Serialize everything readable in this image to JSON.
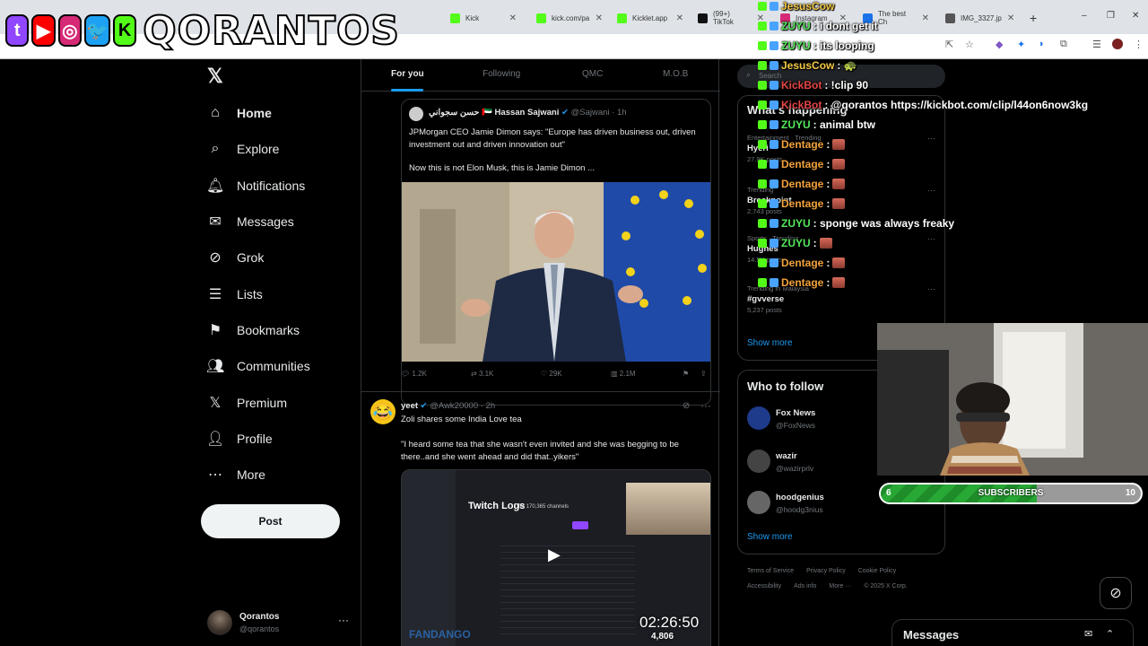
{
  "browser": {
    "tabs": [
      {
        "title": "Kick",
        "color": "#53fc18"
      },
      {
        "title": "kick.com/pa",
        "color": "#53fc18"
      },
      {
        "title": "Kicklet.app",
        "color": "#53fc18"
      },
      {
        "title": "(99+) TikTok",
        "color": "#111111"
      },
      {
        "title": "Instagram",
        "color": "#d62976"
      },
      {
        "title": "The best Ch",
        "color": "#1a73e8"
      },
      {
        "title": "IMG_3327.jp",
        "color": "#555555"
      }
    ],
    "new_tab": "+",
    "window_controls": {
      "minimize": "–",
      "restore": "❐",
      "close": "✕"
    }
  },
  "overlay_logo": {
    "brand": "QORANTOS",
    "icons": [
      "twitch-icon",
      "youtube-icon",
      "instagram-icon",
      "twitter-icon",
      "kick-icon"
    ],
    "icon_glyphs": [
      "t",
      "▶",
      "◎",
      "🐦",
      "K"
    ]
  },
  "sidebar": {
    "logo": "𝕏",
    "items": [
      {
        "label": "Home",
        "icon": "⌂",
        "icon_name": "home-icon",
        "active": true
      },
      {
        "label": "Explore",
        "icon": "⌕",
        "icon_name": "search-icon"
      },
      {
        "label": "Notifications",
        "icon": "🔔︎",
        "icon_name": "bell-icon"
      },
      {
        "label": "Messages",
        "icon": "✉",
        "icon_name": "envelope-icon"
      },
      {
        "label": "Grok",
        "icon": "⊘",
        "icon_name": "grok-icon"
      },
      {
        "label": "Lists",
        "icon": "☰",
        "icon_name": "list-icon"
      },
      {
        "label": "Bookmarks",
        "icon": "⚑",
        "icon_name": "bookmark-icon"
      },
      {
        "label": "Communities",
        "icon": "👥︎",
        "icon_name": "communities-icon"
      },
      {
        "label": "Premium",
        "icon": "𝕏",
        "icon_name": "x-premium-icon"
      },
      {
        "label": "Profile",
        "icon": "👤︎",
        "icon_name": "person-icon"
      },
      {
        "label": "More",
        "icon": "⋯",
        "icon_name": "more-circle-icon"
      }
    ],
    "post_label": "Post",
    "account": {
      "name": "Qorantos",
      "handle": "@qorantos",
      "more": "···"
    }
  },
  "timeline": {
    "tabs": [
      "For you",
      "Following",
      "QMC",
      "M.O.B"
    ],
    "quoted": {
      "name_ar": "حسن سجواني",
      "flag": "🇦🇪",
      "name": "Hassan Sajwani",
      "handle": "@Sajwani",
      "time": "· 1h",
      "text1": "JPMorgan CEO Jamie Dimon says: \"Europe has driven business out, driven investment out and driven innovation out\"",
      "text2": "Now this is not Elon Musk, this is Jamie Dimon ..."
    },
    "actions": {
      "replies": "1.2K",
      "reposts": "3.1K",
      "likes": "29K",
      "views": "2.1M"
    },
    "tweet2": {
      "name": "yeet",
      "handle": "@Awk20000",
      "time": "· 2h",
      "line1": "Zoli shares some India Love tea",
      "line2": "\"I heard some tea that she wasn't even invited and she was begging to be there..and she went ahead and did that..yikers\"",
      "media_title": "Twitch Logs",
      "media_sub": "for 170,365 channels",
      "timer": "02:26:50",
      "counter": "4,806",
      "watermark": "FANDANGO"
    }
  },
  "right": {
    "search_placeholder": "Search",
    "trending_title": "What's happening",
    "trends": [
      {
        "ctx": "Entertainment · Trending",
        "name": "Hyeri",
        "count": "27.9K posts"
      },
      {
        "ctx": "Trending",
        "name": "Breakpoint",
        "count": "2,743 posts"
      },
      {
        "ctx": "Sports · Trending",
        "name": "Hughes",
        "count": "14.5K posts"
      },
      {
        "ctx": "Trending in Malaysia",
        "name": "#gvverse",
        "count": "5,237 posts"
      }
    ],
    "show_more": "Show more",
    "follow_title": "Who to follow",
    "follow": [
      {
        "name": "Fox News",
        "handle": "@FoxNews",
        "color": "#1e3a8a"
      },
      {
        "name": "wazir",
        "handle": "@wazirprlv",
        "color": "#444444"
      },
      {
        "name": "hoodgenius",
        "handle": "@hoodg3nius",
        "color": "#666666"
      }
    ],
    "footer1": [
      "Terms of Service",
      "Privacy Policy",
      "Cookie Policy"
    ],
    "footer2": [
      "Accessibility",
      "Ads info",
      "More ···",
      "© 2025 X Corp."
    ],
    "messages_label": "Messages"
  },
  "chat": [
    {
      "user": "JesusCow",
      "color": "#f2c744",
      "msg": ""
    },
    {
      "user": "ZUYU",
      "color": "#54e85a",
      "msg": ": i dont get it"
    },
    {
      "user": "ZUYU",
      "color": "#54e85a",
      "msg": ": its looping"
    },
    {
      "user": "JesusCow",
      "color": "#f2c744",
      "msg": ": 🐢"
    },
    {
      "user": "KickBot",
      "color": "#e64545",
      "msg": ": !clip 90"
    },
    {
      "user": "KickBot",
      "color": "#e64545",
      "msg": ": @qorantos https://kickbot.com/clip/l44on6now3kg"
    },
    {
      "user": "ZUYU",
      "color": "#54e85a",
      "msg": ": animal btw"
    },
    {
      "user": "Dentage",
      "color": "#f2a23a",
      "msg": ":"
    },
    {
      "user": "Dentage",
      "color": "#f2a23a",
      "msg": ":"
    },
    {
      "user": "Dentage",
      "color": "#f2a23a",
      "msg": ":"
    },
    {
      "user": "Dentage",
      "color": "#f2a23a",
      "msg": ":"
    },
    {
      "user": "ZUYU",
      "color": "#54e85a",
      "msg": ": sponge was always freaky"
    },
    {
      "user": "ZUYU",
      "color": "#54e85a",
      "msg": ":"
    },
    {
      "user": "Dentage",
      "color": "#f2a23a",
      "msg": ":"
    },
    {
      "user": "Dentage",
      "color": "#f2a23a",
      "msg": ":"
    }
  ],
  "subs": {
    "label": "SUBSCRIBERS",
    "current": "6",
    "goal": "10",
    "progress": 0.6
  }
}
